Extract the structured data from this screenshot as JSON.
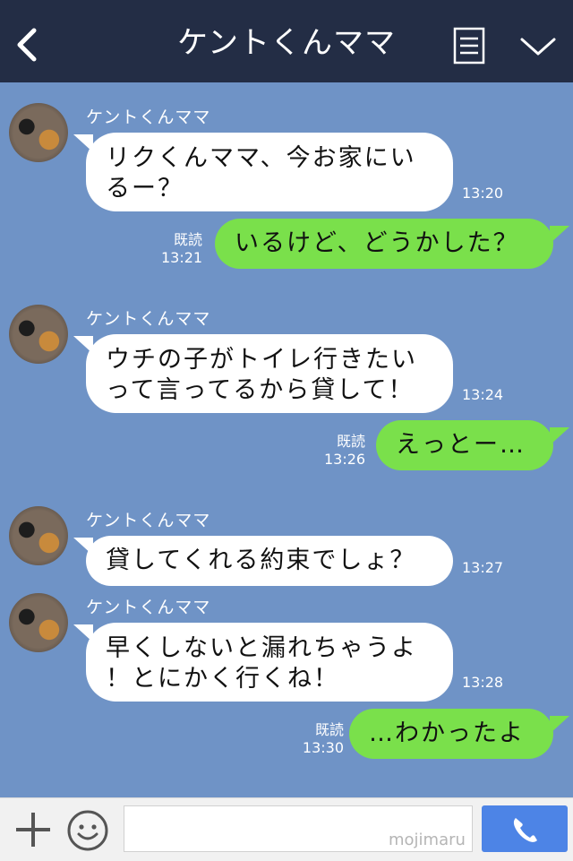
{
  "header": {
    "title": "ケントくんママ",
    "icons": {
      "back": "chevron-left-icon",
      "menu": "menu-icon",
      "collapse": "chevron-down-icon"
    }
  },
  "messages": [
    {
      "direction": "in",
      "sender": "ケントくんママ",
      "lines": [
        "リクくんママ、今お家にい",
        "るー？"
      ],
      "time": "13:20"
    },
    {
      "direction": "out",
      "text": "いるけど、どうかした？",
      "read": "既読",
      "time": "13:21"
    },
    {
      "direction": "in",
      "sender": "ケントくんママ",
      "lines": [
        "ウチの子がトイレ行きたい",
        "って言ってるから貸して！"
      ],
      "time": "13:24"
    },
    {
      "direction": "out",
      "text": "えっとー…",
      "read": "既読",
      "time": "13:26"
    },
    {
      "direction": "in",
      "sender": "ケントくんママ",
      "lines": [
        "貸してくれる約束でしょ？"
      ],
      "time": "13:27"
    },
    {
      "direction": "in",
      "sender": "ケントくんママ",
      "lines": [
        "早くしないと漏れちゃうよ",
        "！とにかく行くね！"
      ],
      "time": "13:28"
    },
    {
      "direction": "out",
      "text": "…わかったよ",
      "read": "既読",
      "time": "13:30"
    }
  ],
  "bottom_bar": {
    "watermark": "mojimaru",
    "icons": {
      "plus": "plus-icon",
      "emoji": "smiley-icon",
      "call": "phone-icon"
    }
  },
  "colors": {
    "chat_background": "#6f93c6",
    "header_background": "#232d45",
    "outgoing_bubble": "#7ae04b",
    "incoming_bubble": "#ffffff",
    "call_button": "#4d84e6"
  }
}
